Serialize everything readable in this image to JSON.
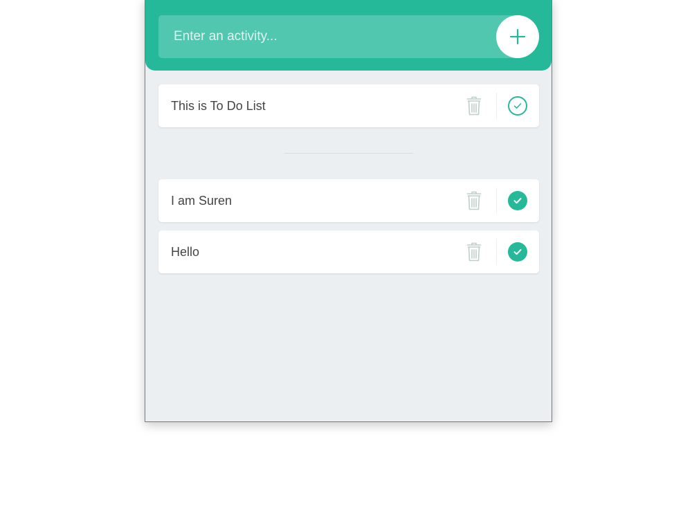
{
  "input": {
    "placeholder": "Enter an activity...",
    "value": ""
  },
  "icons": {
    "add": "plus-icon",
    "remove": "trash-icon",
    "complete": "check-circle-icon"
  },
  "colors": {
    "accent": "#25b99a",
    "background": "#ebeff1",
    "text": "#444444",
    "trash": "#c0cecb"
  },
  "todo": [
    {
      "text": "This is To Do List",
      "done": false
    }
  ],
  "completed": [
    {
      "text": "I am Suren",
      "done": true
    },
    {
      "text": "Hello",
      "done": true
    }
  ]
}
